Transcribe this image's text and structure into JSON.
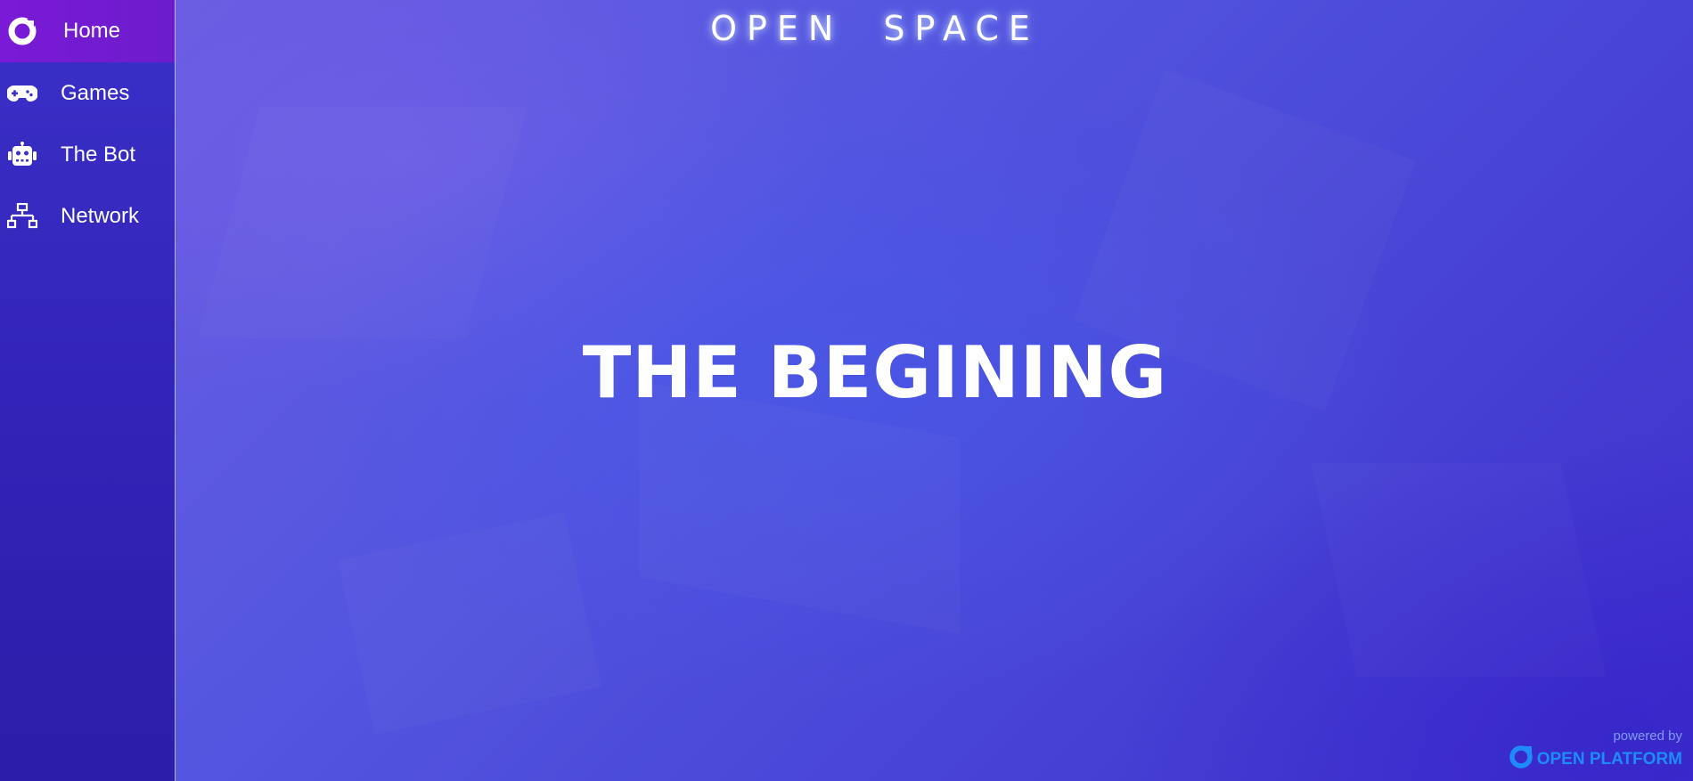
{
  "sidebar": {
    "items": [
      {
        "label": "Home",
        "icon": "home-icon",
        "active": true
      },
      {
        "label": "Games",
        "icon": "gamepad-icon",
        "active": false
      },
      {
        "label": "The Bot",
        "icon": "robot-icon",
        "active": false
      },
      {
        "label": "Network",
        "icon": "network-icon",
        "active": false
      }
    ]
  },
  "header": {
    "title": "OPEN SPACE"
  },
  "hero": {
    "title": "THE BEGINING"
  },
  "footer": {
    "powered_by": "powered by",
    "brand": "OPEN PLATFORM"
  },
  "colors": {
    "sidebar_bg": "#3224b8",
    "active_item": "#7a1ad6",
    "main_bg": "#4a48d8",
    "brand": "#1e8cf8",
    "powered_by": "#7f9cf8"
  }
}
